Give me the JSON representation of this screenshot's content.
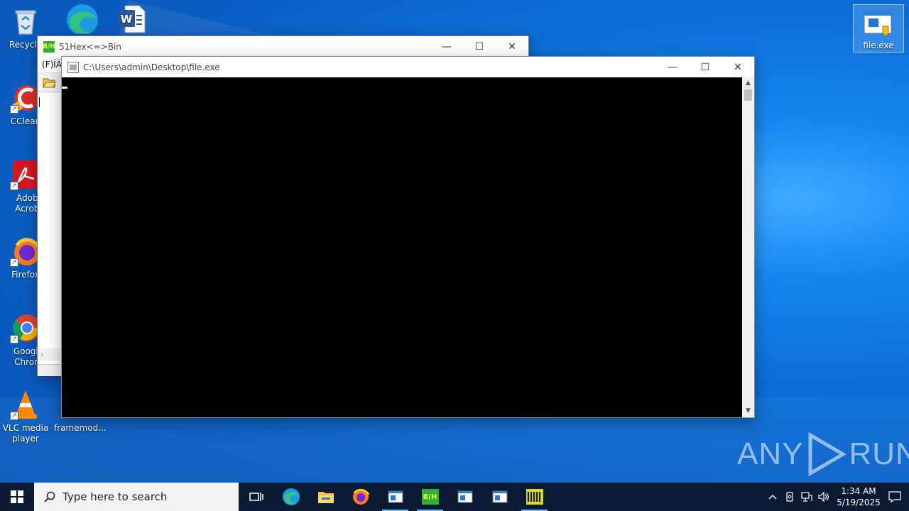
{
  "desktop": {
    "icons": [
      {
        "label": "Recycle",
        "icon": "recycle-bin-icon"
      },
      {
        "label": "CClean",
        "icon": "ccleaner-icon"
      },
      {
        "label": "Adobe Acroba",
        "icon": "acrobat-icon"
      },
      {
        "label": "Firefox",
        "icon": "firefox-icon"
      },
      {
        "label": "Google Chrom",
        "icon": "chrome-icon"
      },
      {
        "label": "VLC media player",
        "icon": "vlc-icon"
      },
      {
        "label": "framemod...",
        "icon": "file-icon"
      },
      {
        "label": "file.exe",
        "icon": "exe-file-icon"
      }
    ],
    "top_icons": [
      "edge-icon",
      "word-icon"
    ]
  },
  "hex_window": {
    "title": "51Hex<=>Bin",
    "menu_label": "(F)ÎÄ",
    "icon_text": "B/H"
  },
  "console_window": {
    "title": "C:\\Users\\admin\\Desktop\\file.exe"
  },
  "taskbar": {
    "search_placeholder": "Type here to search",
    "time": "1:34 AM",
    "date": "5/19/2025",
    "app_icon_text": "B/H"
  },
  "watermark": {
    "text_left": "ANY",
    "text_right": "RUN"
  },
  "colors": {
    "console_bg": "#000000",
    "taskbar_bg": "#0b1a33",
    "accent": "#76b9ed"
  }
}
